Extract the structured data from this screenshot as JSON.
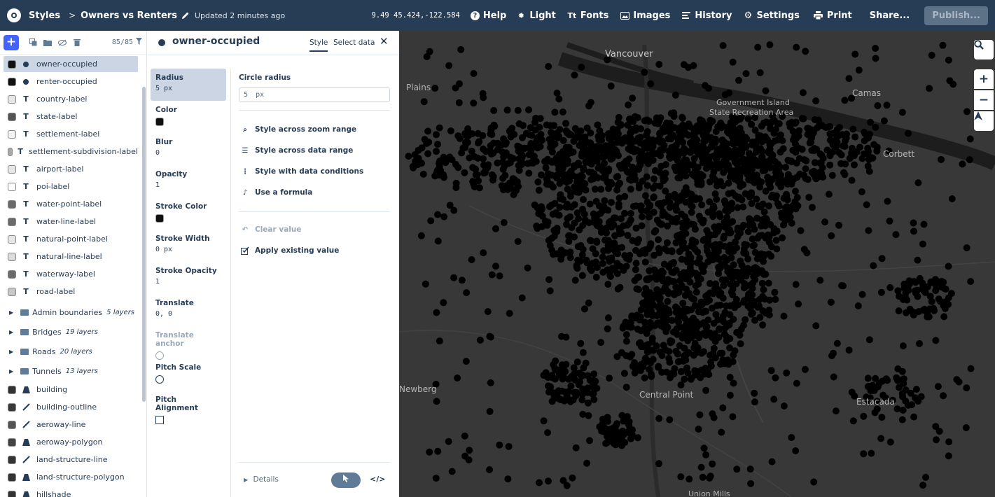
{
  "topbar": {
    "styles_label": "Styles",
    "separator": ">",
    "style_name": "Owners vs Renters",
    "updated": "Updated 2 minutes ago",
    "coords": "9.49 45.424,-122.584",
    "help": "Help",
    "light": "Light",
    "fonts": "Fonts",
    "images": "Images",
    "history": "History",
    "settings": "Settings",
    "print": "Print",
    "share": "Share...",
    "publish": "Publish..."
  },
  "layers": {
    "add": "+",
    "count": "85/85",
    "items": [
      {
        "name": "owner-occupied",
        "type": "circle",
        "swatch": "#111111"
      },
      {
        "name": "renter-occupied",
        "type": "circle",
        "swatch": "#111111"
      },
      {
        "name": "country-label",
        "type": "symbol",
        "swatch": "#e6e6e6"
      },
      {
        "name": "state-label",
        "type": "symbol",
        "swatch": "#555555"
      },
      {
        "name": "settlement-label",
        "type": "symbol",
        "swatch": "#f2f2f2"
      },
      {
        "name": "settlement-subdivision-label",
        "type": "symbol",
        "swatch": "#a8a8a8"
      },
      {
        "name": "airport-label",
        "type": "symbol",
        "swatch": "#e6e6e6"
      },
      {
        "name": "poi-label",
        "type": "symbol",
        "swatch": "#ffffff"
      },
      {
        "name": "water-point-label",
        "type": "symbol",
        "swatch": "#6b6b6b"
      },
      {
        "name": "water-line-label",
        "type": "symbol",
        "swatch": "#6b6b6b"
      },
      {
        "name": "natural-point-label",
        "type": "symbol",
        "swatch": "#e6e6e6"
      },
      {
        "name": "natural-line-label",
        "type": "symbol",
        "swatch": "#dcdcdc"
      },
      {
        "name": "waterway-label",
        "type": "symbol",
        "swatch": "#6b6b6b"
      },
      {
        "name": "road-label",
        "type": "symbol",
        "swatch": "#c8c8c8"
      }
    ],
    "groups": [
      {
        "name": "Admin boundaries",
        "count": "5 layers"
      },
      {
        "name": "Bridges",
        "count": "19 layers"
      },
      {
        "name": "Roads",
        "count": "20 layers"
      },
      {
        "name": "Tunnels",
        "count": "13 layers"
      }
    ],
    "items2": [
      {
        "name": "building",
        "type": "fill",
        "swatch": "#333333"
      },
      {
        "name": "building-outline",
        "type": "line",
        "swatch": "#3a3a3a"
      },
      {
        "name": "aeroway-line",
        "type": "line",
        "swatch": "#555555"
      },
      {
        "name": "aeroway-polygon",
        "type": "fill",
        "swatch": "#444444"
      },
      {
        "name": "land-structure-line",
        "type": "line",
        "swatch": "#333333"
      },
      {
        "name": "land-structure-polygon",
        "type": "fill",
        "swatch": "#333333"
      },
      {
        "name": "hillshade",
        "type": "fill",
        "swatch": "#333333"
      }
    ]
  },
  "panel": {
    "layer_name": "owner-occupied",
    "tab_style": "Style",
    "tab_select": "Select data",
    "properties": [
      {
        "name": "Radius",
        "value": "5 px"
      },
      {
        "name": "Color",
        "value": ""
      },
      {
        "name": "Blur",
        "value": "0"
      },
      {
        "name": "Opacity",
        "value": "1"
      },
      {
        "name": "Stroke Color",
        "value": ""
      },
      {
        "name": "Stroke Width",
        "value": "0 px"
      },
      {
        "name": "Stroke Opacity",
        "value": "1"
      },
      {
        "name": "Translate",
        "value": "0, 0"
      },
      {
        "name": "Translate anchor",
        "value": ""
      },
      {
        "name": "Pitch Scale",
        "value": ""
      },
      {
        "name": "Pitch Alignment",
        "value": ""
      }
    ],
    "editor": {
      "label": "Circle radius",
      "value": "5",
      "unit": "px",
      "options": [
        "Style across zoom range",
        "Style across data range",
        "Style with data conditions",
        "Use a formula"
      ],
      "clear": "Clear value",
      "apply": "Apply existing value"
    },
    "details": "Details",
    "code": "</>"
  },
  "map": {
    "labels": [
      "Vancouver",
      "Camas",
      "Government Island",
      "State Recreation Area",
      "Corbett",
      "Newberg",
      "Central Point",
      "Estacada",
      "Union Mills",
      "Plains"
    ],
    "zoom_in": "+",
    "zoom_out": "−",
    "colors": {
      "land": "#383838",
      "water": "#1d1d1d",
      "points": "#000000"
    }
  }
}
